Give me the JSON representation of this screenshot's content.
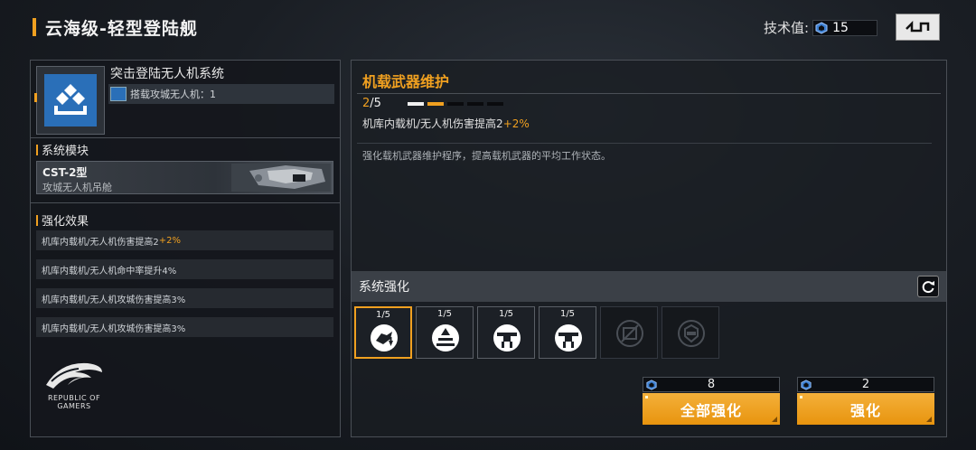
{
  "header": {
    "title": "云海级-轻型登陆舰",
    "tech_label": "技术值:",
    "tech_value": "15"
  },
  "left_panel": {
    "system_name": "突击登陆无人机系统",
    "system_sub": "搭载攻城无人机：1",
    "module_heading": "系统模块",
    "module_code": "CST-2型",
    "module_name": "攻城无人机吊舱",
    "effects_heading": "强化效果",
    "effects": [
      {
        "text": "机库内载机/无人机伤害提高2",
        "plus": "+2%"
      },
      {
        "text": "机库内载机/无人机命中率提升4%",
        "plus": ""
      },
      {
        "text": "机库内载机/无人机攻城伤害提高3%",
        "plus": ""
      },
      {
        "text": "机库内载机/无人机攻城伤害提高3%",
        "plus": ""
      }
    ],
    "logo_text_1": "REPUBLIC OF",
    "logo_text_2": "GAMERS"
  },
  "detail": {
    "title": "机载武器维护",
    "level_current": "2",
    "level_max": "/5",
    "level_value": 2,
    "level_total": 5,
    "effect_text": "机库内载机/无人机伤害提高2",
    "effect_plus": "+2%",
    "description": "强化载机武器维护程序，提高载机武器的平均工作状态。"
  },
  "enhance": {
    "heading": "系统强化",
    "slots": [
      {
        "level": "1/5",
        "icon": "drone-upgrade-icon",
        "selected": true,
        "locked": false
      },
      {
        "level": "1/5",
        "icon": "launch-icon",
        "selected": false,
        "locked": false
      },
      {
        "level": "1/5",
        "icon": "drone-attack-icon",
        "selected": false,
        "locked": false
      },
      {
        "level": "1/5",
        "icon": "drone-attack-icon",
        "selected": false,
        "locked": false
      },
      {
        "level": "",
        "icon": "locked-module-icon",
        "selected": false,
        "locked": true
      },
      {
        "level": "",
        "icon": "locked-shield-icon",
        "selected": false,
        "locked": true
      }
    ],
    "upgrade_all_cost": "8",
    "upgrade_all_label": "全部强化",
    "upgrade_cost": "2",
    "upgrade_label": "强化"
  },
  "colors": {
    "accent": "#f0a020",
    "icon_blue": "#2a6fb8"
  }
}
